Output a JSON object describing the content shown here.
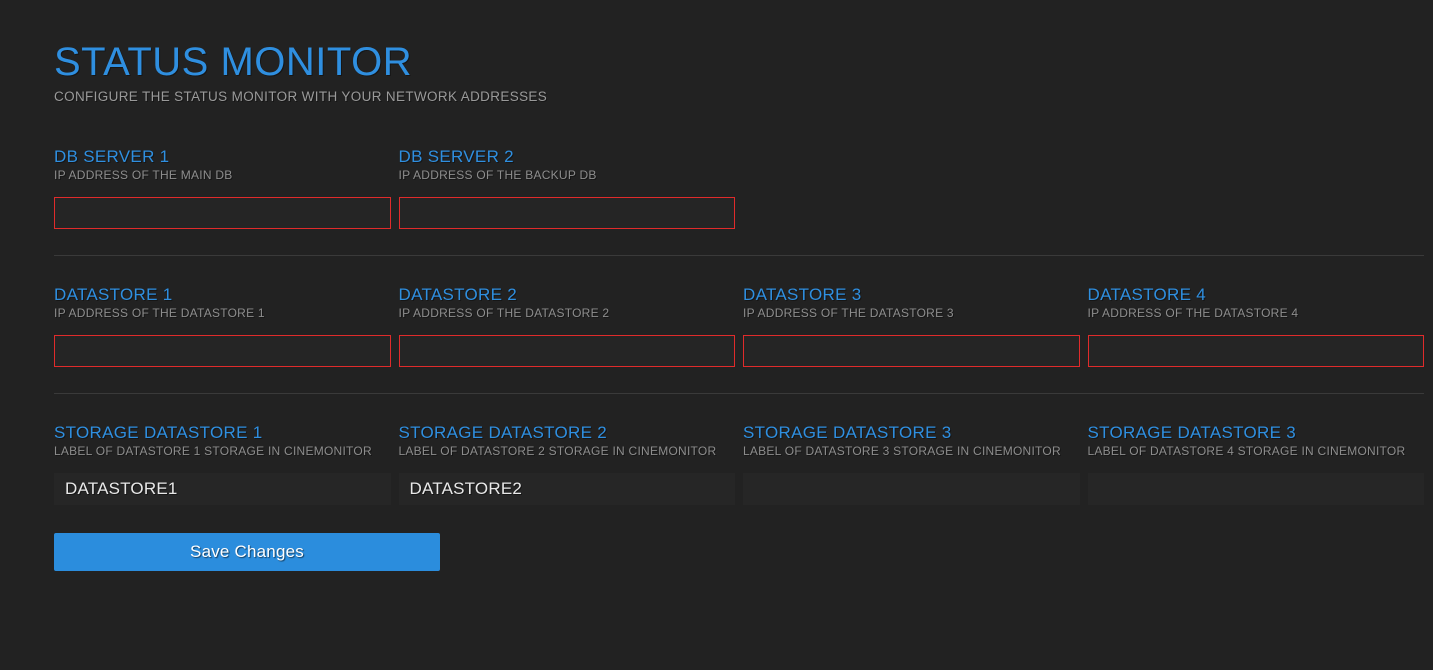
{
  "header": {
    "title": "STATUS MONITOR",
    "subtitle": "CONFIGURE THE STATUS MONITOR WITH YOUR NETWORK ADDRESSES"
  },
  "colors": {
    "accent_blue": "#2f8fe0",
    "button_blue": "#2b8ddd",
    "error_red": "#e02b2b",
    "background": "#222222",
    "input_background": "#262626",
    "hint_text": "#8d8d8d"
  },
  "sections": [
    {
      "id": "db-servers",
      "fields": [
        {
          "label": "DB SERVER 1",
          "hint": "IP ADDRESS OF THE MAIN DB",
          "value": "",
          "placeholder": "",
          "invalid": true
        },
        {
          "label": "DB SERVER 2",
          "hint": "IP ADDRESS OF THE BACKUP DB",
          "value": "",
          "placeholder": "",
          "invalid": true
        }
      ]
    },
    {
      "id": "datastores",
      "fields": [
        {
          "label": "DATASTORE 1",
          "hint": "IP ADDRESS OF THE DATASTORE 1",
          "value": "",
          "placeholder": "",
          "invalid": true
        },
        {
          "label": "DATASTORE 2",
          "hint": "IP ADDRESS OF THE DATASTORE 2",
          "value": "",
          "placeholder": "",
          "invalid": true
        },
        {
          "label": "DATASTORE 3",
          "hint": "IP ADDRESS OF THE DATASTORE 3",
          "value": "",
          "placeholder": "",
          "invalid": true
        },
        {
          "label": "DATASTORE 4",
          "hint": "IP ADDRESS OF THE DATASTORE 4",
          "value": "",
          "placeholder": "",
          "invalid": true
        }
      ]
    },
    {
      "id": "storage-datastores",
      "fields": [
        {
          "label": "STORAGE DATASTORE 1",
          "hint": "LABEL OF DATASTORE 1 STORAGE IN CINEMONITOR",
          "value": "DATASTORE1",
          "placeholder": "",
          "invalid": false
        },
        {
          "label": "STORAGE DATASTORE 2",
          "hint": "LABEL OF DATASTORE 2 STORAGE IN CINEMONITOR",
          "value": "DATASTORE2",
          "placeholder": "",
          "invalid": false
        },
        {
          "label": "STORAGE DATASTORE 3",
          "hint": "LABEL OF DATASTORE 3 STORAGE IN CINEMONITOR",
          "value": "",
          "placeholder": "",
          "invalid": false
        },
        {
          "label": "STORAGE DATASTORE 3",
          "hint": "LABEL OF DATASTORE 4 STORAGE IN CINEMONITOR",
          "value": "",
          "placeholder": "",
          "invalid": false
        }
      ]
    }
  ],
  "actions": {
    "save_label": "Save Changes"
  }
}
